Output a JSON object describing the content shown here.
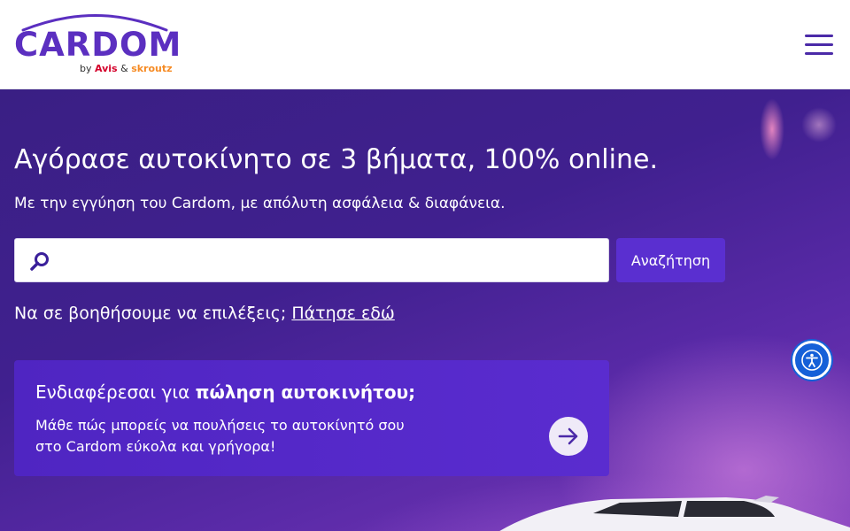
{
  "header": {
    "logo_text": "CARDOM",
    "logo_by": "by",
    "logo_avis": "Avis",
    "logo_amp": "&",
    "logo_skroutz": "skroutz",
    "menu_icon": "hamburger-menu-icon"
  },
  "hero": {
    "title": "Αγόρασε αυτοκίνητο σε 3 βήματα, 100% online.",
    "subtitle": "Με την εγγύηση του Cardom, με απόλυτη ασφάλεια & διαφάνεια.",
    "search": {
      "placeholder": "",
      "value": "",
      "icon": "search-icon",
      "button_label": "Αναζήτηση"
    },
    "help_text": "Να σε βοηθήσουμε να επιλέξεις;",
    "help_link": "Πάτησε εδώ"
  },
  "sell_card": {
    "title_prefix": "Ενδιαφέρεσαι για ",
    "title_bold": "πώληση αυτοκινήτου;",
    "text": "Μάθε πώς μπορείς να πουλήσεις το αυτοκίνητό σου στο Cardom εύκολα και γρήγορα!",
    "arrow_icon": "arrow-right-icon"
  },
  "accessibility": {
    "icon": "accessibility-icon"
  },
  "colors": {
    "brand_purple": "#5b2fc0",
    "button_purple": "#5a2fd0",
    "avis_red": "#d4002a",
    "skroutz_orange": "#f68b24",
    "a11y_blue": "#1560d8"
  }
}
